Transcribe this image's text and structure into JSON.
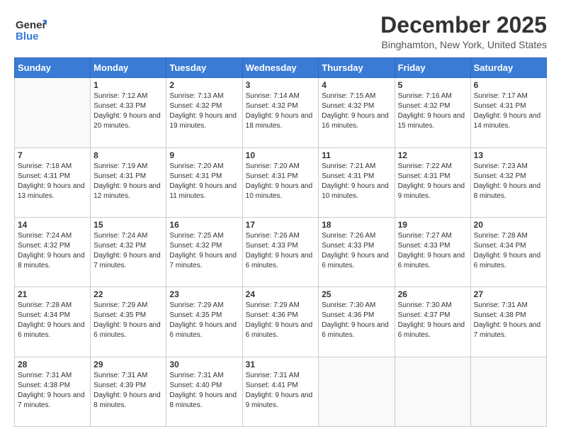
{
  "header": {
    "logo_general": "General",
    "logo_blue": "Blue",
    "month_title": "December 2025",
    "location": "Binghamton, New York, United States"
  },
  "weekdays": [
    "Sunday",
    "Monday",
    "Tuesday",
    "Wednesday",
    "Thursday",
    "Friday",
    "Saturday"
  ],
  "weeks": [
    [
      {
        "day": "",
        "sunrise": "",
        "sunset": "",
        "daylight": ""
      },
      {
        "day": "1",
        "sunrise": "Sunrise: 7:12 AM",
        "sunset": "Sunset: 4:33 PM",
        "daylight": "Daylight: 9 hours and 20 minutes."
      },
      {
        "day": "2",
        "sunrise": "Sunrise: 7:13 AM",
        "sunset": "Sunset: 4:32 PM",
        "daylight": "Daylight: 9 hours and 19 minutes."
      },
      {
        "day": "3",
        "sunrise": "Sunrise: 7:14 AM",
        "sunset": "Sunset: 4:32 PM",
        "daylight": "Daylight: 9 hours and 18 minutes."
      },
      {
        "day": "4",
        "sunrise": "Sunrise: 7:15 AM",
        "sunset": "Sunset: 4:32 PM",
        "daylight": "Daylight: 9 hours and 16 minutes."
      },
      {
        "day": "5",
        "sunrise": "Sunrise: 7:16 AM",
        "sunset": "Sunset: 4:32 PM",
        "daylight": "Daylight: 9 hours and 15 minutes."
      },
      {
        "day": "6",
        "sunrise": "Sunrise: 7:17 AM",
        "sunset": "Sunset: 4:31 PM",
        "daylight": "Daylight: 9 hours and 14 minutes."
      }
    ],
    [
      {
        "day": "7",
        "sunrise": "Sunrise: 7:18 AM",
        "sunset": "Sunset: 4:31 PM",
        "daylight": "Daylight: 9 hours and 13 minutes."
      },
      {
        "day": "8",
        "sunrise": "Sunrise: 7:19 AM",
        "sunset": "Sunset: 4:31 PM",
        "daylight": "Daylight: 9 hours and 12 minutes."
      },
      {
        "day": "9",
        "sunrise": "Sunrise: 7:20 AM",
        "sunset": "Sunset: 4:31 PM",
        "daylight": "Daylight: 9 hours and 11 minutes."
      },
      {
        "day": "10",
        "sunrise": "Sunrise: 7:20 AM",
        "sunset": "Sunset: 4:31 PM",
        "daylight": "Daylight: 9 hours and 10 minutes."
      },
      {
        "day": "11",
        "sunrise": "Sunrise: 7:21 AM",
        "sunset": "Sunset: 4:31 PM",
        "daylight": "Daylight: 9 hours and 10 minutes."
      },
      {
        "day": "12",
        "sunrise": "Sunrise: 7:22 AM",
        "sunset": "Sunset: 4:31 PM",
        "daylight": "Daylight: 9 hours and 9 minutes."
      },
      {
        "day": "13",
        "sunrise": "Sunrise: 7:23 AM",
        "sunset": "Sunset: 4:32 PM",
        "daylight": "Daylight: 9 hours and 8 minutes."
      }
    ],
    [
      {
        "day": "14",
        "sunrise": "Sunrise: 7:24 AM",
        "sunset": "Sunset: 4:32 PM",
        "daylight": "Daylight: 9 hours and 8 minutes."
      },
      {
        "day": "15",
        "sunrise": "Sunrise: 7:24 AM",
        "sunset": "Sunset: 4:32 PM",
        "daylight": "Daylight: 9 hours and 7 minutes."
      },
      {
        "day": "16",
        "sunrise": "Sunrise: 7:25 AM",
        "sunset": "Sunset: 4:32 PM",
        "daylight": "Daylight: 9 hours and 7 minutes."
      },
      {
        "day": "17",
        "sunrise": "Sunrise: 7:26 AM",
        "sunset": "Sunset: 4:33 PM",
        "daylight": "Daylight: 9 hours and 6 minutes."
      },
      {
        "day": "18",
        "sunrise": "Sunrise: 7:26 AM",
        "sunset": "Sunset: 4:33 PM",
        "daylight": "Daylight: 9 hours and 6 minutes."
      },
      {
        "day": "19",
        "sunrise": "Sunrise: 7:27 AM",
        "sunset": "Sunset: 4:33 PM",
        "daylight": "Daylight: 9 hours and 6 minutes."
      },
      {
        "day": "20",
        "sunrise": "Sunrise: 7:28 AM",
        "sunset": "Sunset: 4:34 PM",
        "daylight": "Daylight: 9 hours and 6 minutes."
      }
    ],
    [
      {
        "day": "21",
        "sunrise": "Sunrise: 7:28 AM",
        "sunset": "Sunset: 4:34 PM",
        "daylight": "Daylight: 9 hours and 6 minutes."
      },
      {
        "day": "22",
        "sunrise": "Sunrise: 7:29 AM",
        "sunset": "Sunset: 4:35 PM",
        "daylight": "Daylight: 9 hours and 6 minutes."
      },
      {
        "day": "23",
        "sunrise": "Sunrise: 7:29 AM",
        "sunset": "Sunset: 4:35 PM",
        "daylight": "Daylight: 9 hours and 6 minutes."
      },
      {
        "day": "24",
        "sunrise": "Sunrise: 7:29 AM",
        "sunset": "Sunset: 4:36 PM",
        "daylight": "Daylight: 9 hours and 6 minutes."
      },
      {
        "day": "25",
        "sunrise": "Sunrise: 7:30 AM",
        "sunset": "Sunset: 4:36 PM",
        "daylight": "Daylight: 9 hours and 6 minutes."
      },
      {
        "day": "26",
        "sunrise": "Sunrise: 7:30 AM",
        "sunset": "Sunset: 4:37 PM",
        "daylight": "Daylight: 9 hours and 6 minutes."
      },
      {
        "day": "27",
        "sunrise": "Sunrise: 7:31 AM",
        "sunset": "Sunset: 4:38 PM",
        "daylight": "Daylight: 9 hours and 7 minutes."
      }
    ],
    [
      {
        "day": "28",
        "sunrise": "Sunrise: 7:31 AM",
        "sunset": "Sunset: 4:38 PM",
        "daylight": "Daylight: 9 hours and 7 minutes."
      },
      {
        "day": "29",
        "sunrise": "Sunrise: 7:31 AM",
        "sunset": "Sunset: 4:39 PM",
        "daylight": "Daylight: 9 hours and 8 minutes."
      },
      {
        "day": "30",
        "sunrise": "Sunrise: 7:31 AM",
        "sunset": "Sunset: 4:40 PM",
        "daylight": "Daylight: 9 hours and 8 minutes."
      },
      {
        "day": "31",
        "sunrise": "Sunrise: 7:31 AM",
        "sunset": "Sunset: 4:41 PM",
        "daylight": "Daylight: 9 hours and 9 minutes."
      },
      {
        "day": "",
        "sunrise": "",
        "sunset": "",
        "daylight": ""
      },
      {
        "day": "",
        "sunrise": "",
        "sunset": "",
        "daylight": ""
      },
      {
        "day": "",
        "sunrise": "",
        "sunset": "",
        "daylight": ""
      }
    ]
  ]
}
